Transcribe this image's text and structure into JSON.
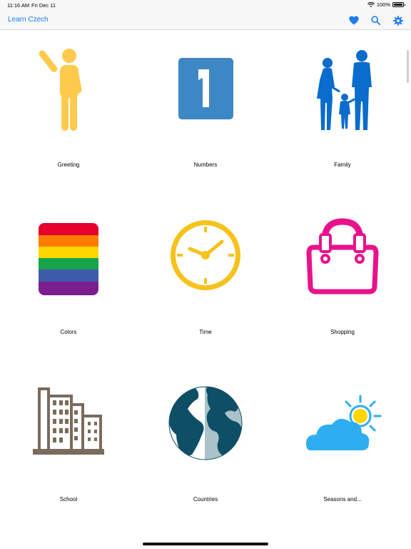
{
  "status_bar": {
    "time": "11:16 AM",
    "date": "Fri Dec 11",
    "battery": "100%",
    "icons": [
      "wifi-icon",
      "battery-icon"
    ]
  },
  "nav": {
    "title": "Learn Czech",
    "accent_color": "#1a7cf2",
    "actions": [
      "heart-icon",
      "search-icon",
      "gear-icon"
    ]
  },
  "categories": [
    {
      "label": "Greeting",
      "icon": "greeting-person-icon",
      "color": "#ffc94b"
    },
    {
      "label": "Numbers",
      "icon": "number-one-icon",
      "color": "#3e87c5"
    },
    {
      "label": "Family",
      "icon": "family-icon",
      "color": "#0a6ccc"
    },
    {
      "label": "Colors",
      "icon": "rainbow-icon",
      "color": "#e4002b"
    },
    {
      "label": "Time",
      "icon": "clock-icon",
      "color": "#f6c21b"
    },
    {
      "label": "Shopping",
      "icon": "handbag-icon",
      "color": "#e8128c"
    },
    {
      "label": "School",
      "icon": "buildings-icon",
      "color": "#7a6b5d"
    },
    {
      "label": "Countries",
      "icon": "globe-icon",
      "color": "#0f4f66"
    },
    {
      "label": "Seasons and...",
      "icon": "weather-icon",
      "color": "#2eaef0"
    }
  ]
}
